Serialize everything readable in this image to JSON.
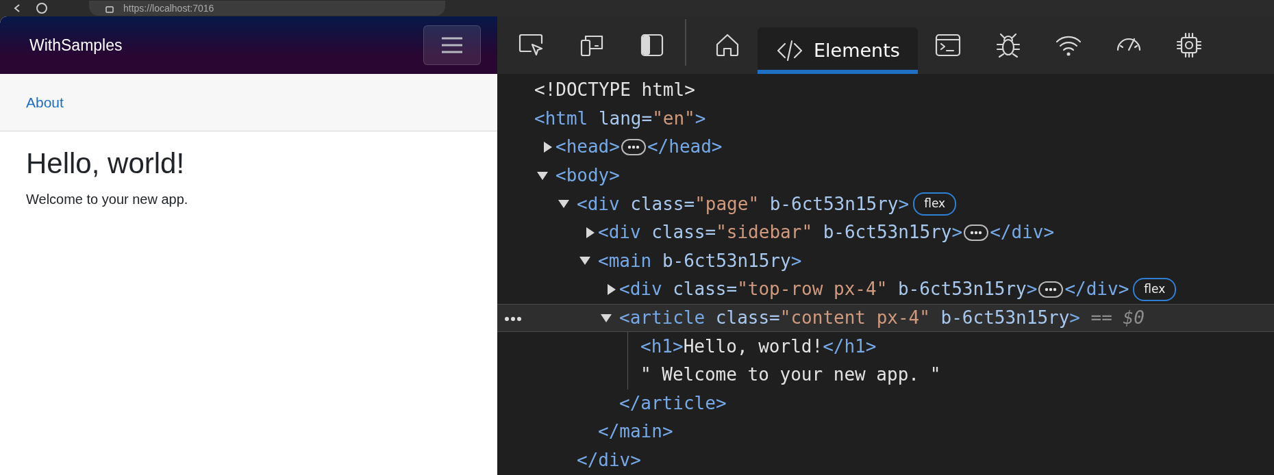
{
  "browser": {
    "url": "https://localhost:7016"
  },
  "app": {
    "brand": "WithSamples",
    "nav_items": [
      {
        "label": "About"
      }
    ],
    "heading": "Hello, world!",
    "text": "Welcome to your new app."
  },
  "devtools": {
    "tabs": [
      {
        "kind": "home",
        "selected": false
      },
      {
        "kind": "elements",
        "label": "Elements",
        "selected": true
      },
      {
        "kind": "console",
        "selected": false
      },
      {
        "kind": "sources",
        "selected": false
      },
      {
        "kind": "network",
        "selected": false
      },
      {
        "kind": "performance",
        "selected": false
      },
      {
        "kind": "memory",
        "selected": false
      }
    ],
    "tree": [
      {
        "selected": false,
        "tokens": [
          {
            "kind": "text",
            "text": "<!DOCTYPE html>"
          }
        ]
      },
      {
        "selected": false,
        "tokens": [
          {
            "kind": "tag",
            "text": "<html"
          },
          {
            "kind": "attr",
            "text": "lang"
          },
          {
            "kind": "eq",
            "text": "="
          },
          {
            "kind": "value",
            "text": "\"en\""
          },
          {
            "kind": "tag",
            "text": ">"
          }
        ],
        "children": [
          {
            "selected": false,
            "expanded": false,
            "tokens": [
              {
                "kind": "tag",
                "text": "<head>"
              },
              {
                "kind": "ellipsis"
              },
              {
                "kind": "tag",
                "text": "</head>"
              }
            ]
          },
          {
            "selected": false,
            "expanded": true,
            "tokens": [
              {
                "kind": "tag",
                "text": "<body>"
              }
            ],
            "children": [
              {
                "selected": false,
                "expanded": true,
                "tokens": [
                  {
                    "kind": "tag",
                    "text": "<div"
                  },
                  {
                    "kind": "attr",
                    "text": "class"
                  },
                  {
                    "kind": "eq",
                    "text": "="
                  },
                  {
                    "kind": "value",
                    "text": "\"page\""
                  },
                  {
                    "kind": "attr",
                    "text": "b-6ct53n15ry"
                  },
                  {
                    "kind": "tag",
                    "text": ">"
                  },
                  {
                    "kind": "badge",
                    "text": "flex"
                  }
                ],
                "closing": "</div>",
                "children": [
                  {
                    "selected": false,
                    "expanded": false,
                    "tokens": [
                      {
                        "kind": "tag",
                        "text": "<div"
                      },
                      {
                        "kind": "attr",
                        "text": "class"
                      },
                      {
                        "kind": "eq",
                        "text": "="
                      },
                      {
                        "kind": "value",
                        "text": "\"sidebar\""
                      },
                      {
                        "kind": "attr",
                        "text": "b-6ct53n15ry"
                      },
                      {
                        "kind": "tag",
                        "text": ">"
                      },
                      {
                        "kind": "ellipsis"
                      },
                      {
                        "kind": "tag",
                        "text": "</div>"
                      }
                    ]
                  },
                  {
                    "selected": false,
                    "expanded": true,
                    "tokens": [
                      {
                        "kind": "tag",
                        "text": "<main"
                      },
                      {
                        "kind": "attr",
                        "text": "b-6ct53n15ry"
                      },
                      {
                        "kind": "tag",
                        "text": ">"
                      }
                    ],
                    "closing": "</main>",
                    "children": [
                      {
                        "selected": false,
                        "expanded": false,
                        "tokens": [
                          {
                            "kind": "tag",
                            "text": "<div"
                          },
                          {
                            "kind": "attr",
                            "text": "class"
                          },
                          {
                            "kind": "eq",
                            "text": "="
                          },
                          {
                            "kind": "value",
                            "text": "\"top-row px-4\""
                          },
                          {
                            "kind": "attr",
                            "text": "b-6ct53n15ry"
                          },
                          {
                            "kind": "tag",
                            "text": ">"
                          },
                          {
                            "kind": "ellipsis"
                          },
                          {
                            "kind": "tag",
                            "text": "</div>"
                          },
                          {
                            "kind": "badge",
                            "text": "flex"
                          }
                        ]
                      },
                      {
                        "selected": true,
                        "expanded": true,
                        "tokens": [
                          {
                            "kind": "tag",
                            "text": "<article"
                          },
                          {
                            "kind": "attr",
                            "text": "class"
                          },
                          {
                            "kind": "eq",
                            "text": "="
                          },
                          {
                            "kind": "value",
                            "text": "\"content px-4\""
                          },
                          {
                            "kind": "attr",
                            "text": "b-6ct53n15ry"
                          },
                          {
                            "kind": "tag",
                            "text": ">"
                          },
                          {
                            "kind": "ref",
                            "text": "== $0"
                          }
                        ],
                        "closing": "</article>",
                        "children": [
                          {
                            "selected": false,
                            "tokens": [
                              {
                                "kind": "tag",
                                "text": "<h1>"
                              },
                              {
                                "kind": "text",
                                "text": "Hello, world!"
                              },
                              {
                                "kind": "tag",
                                "text": "</h1>"
                              }
                            ]
                          },
                          {
                            "selected": false,
                            "tokens": [
                              {
                                "kind": "text",
                                "text": "\" Welcome to your new app. \""
                              }
                            ]
                          }
                        ]
                      }
                    ]
                  }
                ]
              }
            ]
          }
        ]
      }
    ]
  }
}
